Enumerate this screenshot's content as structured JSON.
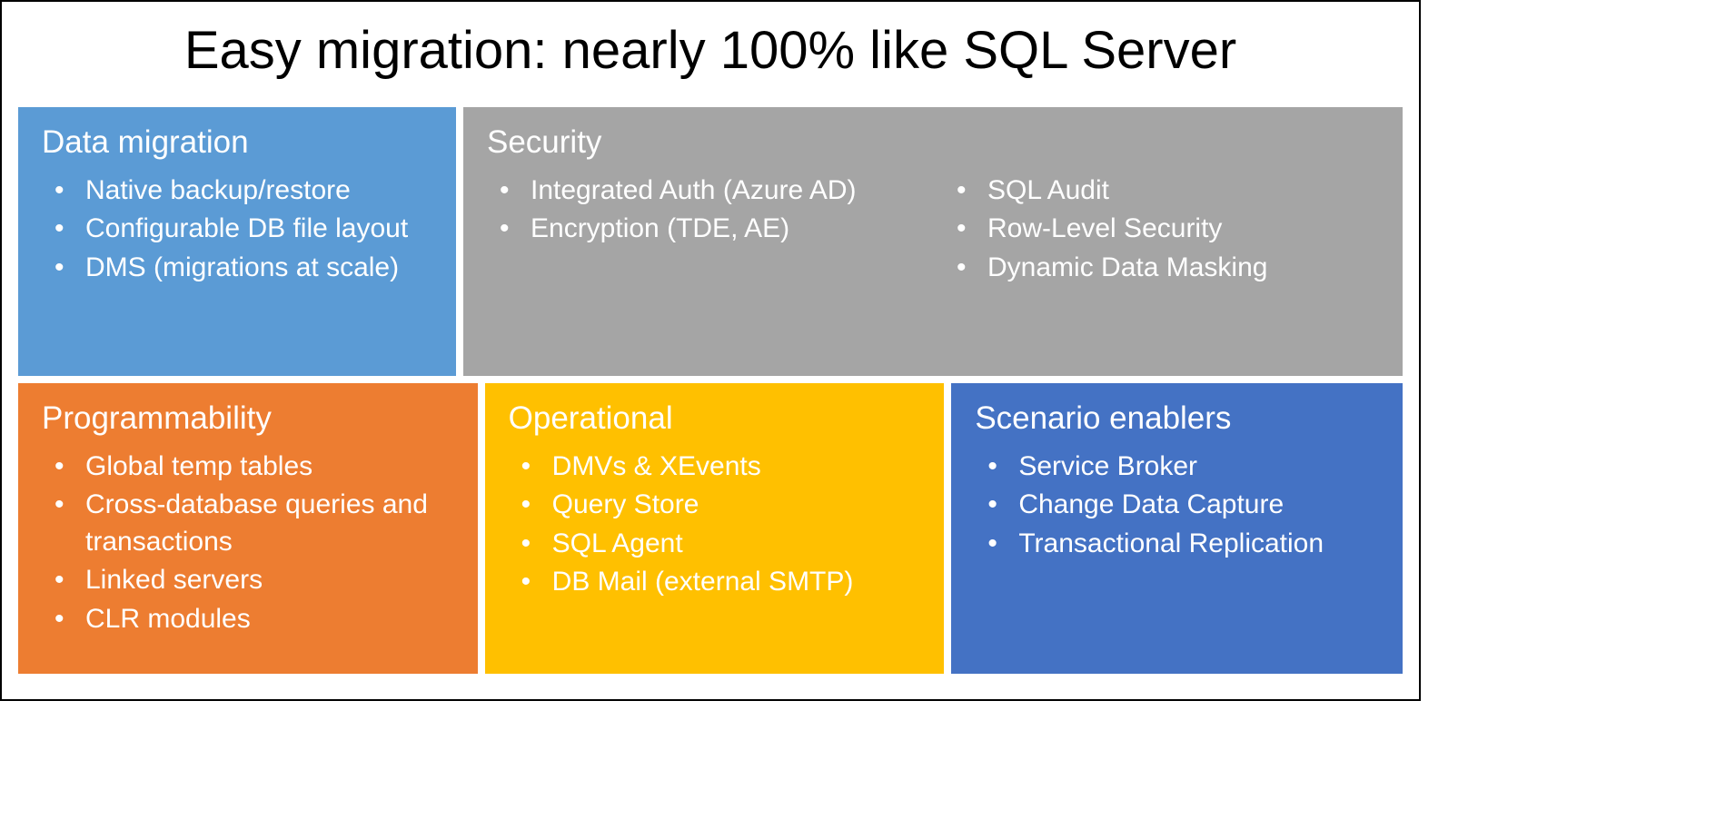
{
  "title": "Easy migration: nearly 100% like SQL Server",
  "cards": {
    "dataMigration": {
      "title": "Data migration",
      "items": [
        "Native backup/restore",
        "Configurable DB file layout",
        "DMS (migrations at scale)"
      ]
    },
    "security": {
      "title": "Security",
      "col1": [
        "Integrated Auth (Azure AD)",
        "Encryption (TDE, AE)"
      ],
      "col2": [
        "SQL Audit",
        "Row-Level Security",
        "Dynamic Data Masking"
      ]
    },
    "programmability": {
      "title": "Programmability",
      "items": [
        "Global temp tables",
        "Cross-database queries and transactions",
        "Linked servers",
        "CLR modules"
      ]
    },
    "operational": {
      "title": "Operational",
      "items": [
        "DMVs & XEvents",
        "Query Store",
        "SQL Agent",
        "DB Mail (external SMTP)"
      ]
    },
    "scenarioEnablers": {
      "title": "Scenario enablers",
      "items": [
        "Service Broker",
        "Change Data Capture",
        "Transactional Replication"
      ]
    }
  }
}
